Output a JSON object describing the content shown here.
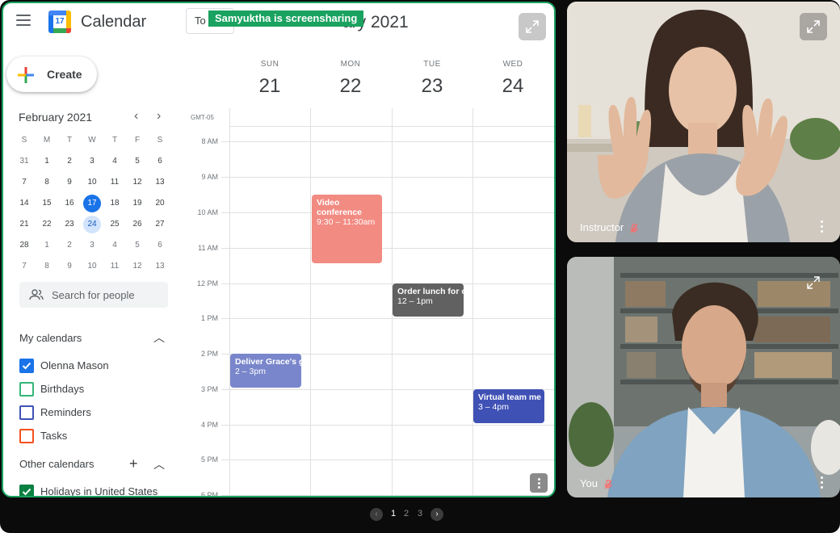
{
  "app": {
    "title": "Calendar",
    "logo_day": "17"
  },
  "header": {
    "today_label": "To",
    "month_title": "ary 2021"
  },
  "share_banner": "Samyuktha is screensharing",
  "sidebar": {
    "create_label": "Create",
    "mini": {
      "month": "February 2021",
      "prev": "‹",
      "next": "›",
      "weekdays": [
        "S",
        "M",
        "T",
        "W",
        "T",
        "F",
        "S"
      ],
      "weeks": [
        [
          "31",
          "1",
          "2",
          "3",
          "4",
          "5",
          "6"
        ],
        [
          "7",
          "8",
          "9",
          "10",
          "11",
          "12",
          "13"
        ],
        [
          "14",
          "15",
          "16",
          "17",
          "18",
          "19",
          "20"
        ],
        [
          "21",
          "22",
          "23",
          "24",
          "25",
          "26",
          "27"
        ],
        [
          "28",
          "1",
          "2",
          "3",
          "4",
          "5",
          "6"
        ],
        [
          "7",
          "8",
          "9",
          "10",
          "11",
          "12",
          "13"
        ]
      ]
    },
    "search_placeholder": "Search for people",
    "my_calendars": {
      "title": "My calendars",
      "items": [
        {
          "name": "Olenna Mason",
          "color": "#1a73e8",
          "checked": true
        },
        {
          "name": "Birthdays",
          "color": "#33b679",
          "checked": false
        },
        {
          "name": "Reminders",
          "color": "#3f51b5",
          "checked": false
        },
        {
          "name": "Tasks",
          "color": "#f4511e",
          "checked": false
        }
      ]
    },
    "other_calendars": {
      "title": "Other calendars",
      "add": "+",
      "items": [
        {
          "name": "Holidays in United States",
          "color": "#0b8043",
          "checked": true
        }
      ]
    }
  },
  "week": {
    "timezone": "GMT-05",
    "days": [
      {
        "name": "SUN",
        "date": "21"
      },
      {
        "name": "MON",
        "date": "22"
      },
      {
        "name": "TUE",
        "date": "23"
      },
      {
        "name": "WED",
        "date": "24"
      }
    ],
    "times": [
      "8 AM",
      "9 AM",
      "10 AM",
      "11 AM",
      "12 PM",
      "1 PM",
      "2 PM",
      "3 PM",
      "4 PM",
      "5 PM",
      "6 PM"
    ],
    "events": [
      {
        "title": "Video conference",
        "time": "9:30 – 11:30am",
        "color": "#f28b82"
      },
      {
        "title": "Order lunch for o",
        "time": "12 – 1pm",
        "color": "#616161"
      },
      {
        "title": "Deliver Grace's g",
        "time": "2 – 3pm",
        "color": "#7986cb"
      },
      {
        "title": "Virtual team me",
        "time": "3 – 4pm",
        "color": "#3f51b5"
      }
    ]
  },
  "participants": [
    {
      "name": "Instructor",
      "muted": true
    },
    {
      "name": "You",
      "muted": true
    }
  ],
  "pagination": {
    "pages": [
      "1",
      "2",
      "3"
    ],
    "current": "1",
    "prev": "‹",
    "next": "›"
  }
}
